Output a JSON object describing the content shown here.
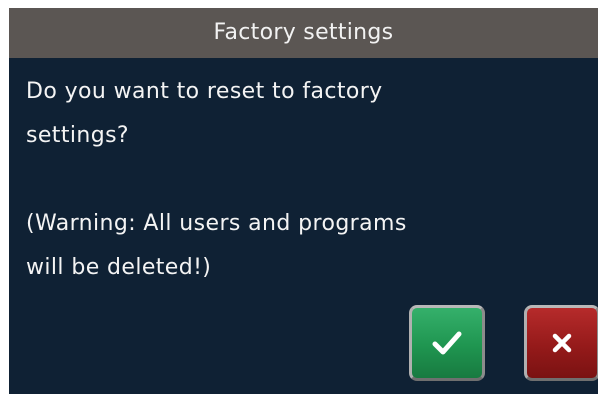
{
  "dialog": {
    "title": "Factory settings",
    "message": {
      "line1": "Do you want to reset to factory",
      "line2": "settings?",
      "line3": "(Warning: All users and programs",
      "line4": "will be deleted!)"
    },
    "confirm_icon": "checkmark-icon",
    "cancel_icon": "close-icon"
  },
  "colors": {
    "dialog_background": "#0f2134",
    "title_bar": "#5b5653",
    "confirm_button": "#1f9550",
    "cancel_button": "#951a1a",
    "text": "#f4f4f4"
  }
}
